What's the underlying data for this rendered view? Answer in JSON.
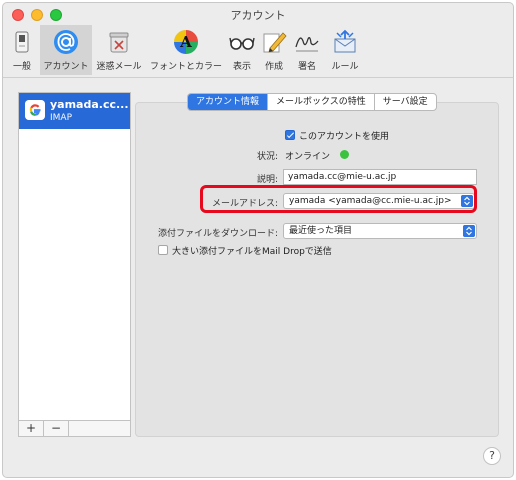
{
  "window": {
    "title": "アカウント"
  },
  "toolbar": {
    "items": [
      {
        "label": "一般",
        "icon": "switch-icon"
      },
      {
        "label": "アカウント",
        "icon": "at-sign-icon"
      },
      {
        "label": "迷惑メール",
        "icon": "junk-bin-icon"
      },
      {
        "label": "フォントとカラー",
        "icon": "color-font-icon"
      },
      {
        "label": "表示",
        "icon": "glasses-icon"
      },
      {
        "label": "作成",
        "icon": "pencil-icon"
      },
      {
        "label": "署名",
        "icon": "signature-icon"
      },
      {
        "label": "ルール",
        "icon": "rules-icon"
      }
    ]
  },
  "sidebar": {
    "account": {
      "name": "yamada.cc...",
      "type": "IMAP",
      "icon": "google-icon"
    },
    "add_label": "+",
    "remove_label": "−"
  },
  "tabs": [
    {
      "label": "アカウント情報",
      "active": true
    },
    {
      "label": "メールボックスの特性",
      "active": false
    },
    {
      "label": "サーバ設定",
      "active": false
    }
  ],
  "form": {
    "enable_label": "このアカウントを使用",
    "enable_checked": true,
    "status_label": "状況:",
    "status_value": "オンライン",
    "status_color": "#3bc23f",
    "description_label": "説明:",
    "description_value": "yamada.cc@mie-u.ac.jp",
    "email_label": "メールアドレス:",
    "email_value": "yamada <yamada@cc.mie-u.ac.jp>",
    "download_label": "添付ファイルをダウンロード:",
    "download_value": "最近使った項目",
    "maildrop_label": "大きい添付ファイルをMail Dropで送信",
    "maildrop_checked": false
  },
  "help_label": "?",
  "colors": {
    "accent": "#2f76e2",
    "selection": "#2869d8",
    "highlight": "#e8081d"
  }
}
